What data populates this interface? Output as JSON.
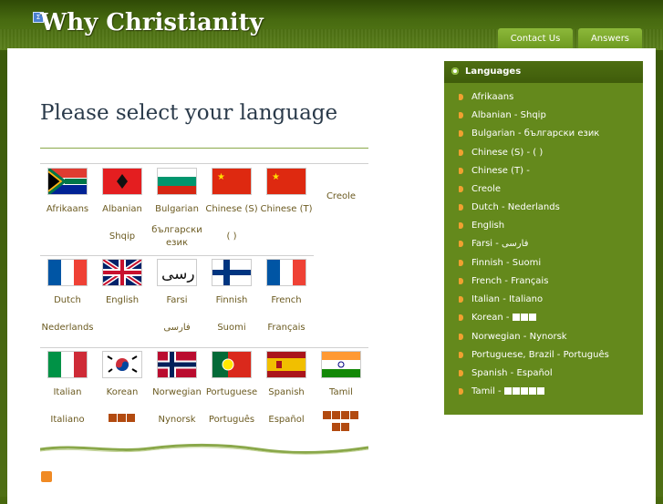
{
  "header": {
    "title": "Why Christianity",
    "tabs": [
      "Contact Us",
      "Answers"
    ]
  },
  "main": {
    "heading": "Please select your language",
    "languages": [
      {
        "name": "Afrikaans",
        "native": ""
      },
      {
        "name": "Albanian",
        "native": "Shqip"
      },
      {
        "name": "Bulgarian",
        "native": "български език"
      },
      {
        "name": "Chinese (S)",
        "native": "(   )"
      },
      {
        "name": "Chinese (T)",
        "native": ""
      },
      {
        "name": "Creole",
        "native": ""
      },
      {
        "name": "Dutch",
        "native": "Nederlands"
      },
      {
        "name": "English",
        "native": ""
      },
      {
        "name": "Farsi",
        "native": "فارسی"
      },
      {
        "name": "Finnish",
        "native": "Suomi"
      },
      {
        "name": "French",
        "native": "Français"
      },
      {
        "name": "Italian",
        "native": "Italiano"
      },
      {
        "name": "Korean",
        "native": ""
      },
      {
        "name": "Norwegian",
        "native": "Nynorsk"
      },
      {
        "name": "Portuguese",
        "native": "Português"
      },
      {
        "name": "Spanish",
        "native": "Español"
      },
      {
        "name": "Tamil",
        "native": ""
      }
    ]
  },
  "sidebar": {
    "title": "Languages",
    "items": [
      "Afrikaans",
      "Albanian - Shqip",
      "Bulgarian - български език",
      "Chinese (S) -    (   )",
      "Chinese (T) -",
      "Creole",
      "Dutch - Nederlands",
      "English",
      "Farsi - فارسی",
      "Finnish - Suomi",
      "French - Français",
      "Italian - Italiano",
      "Korean -",
      "Norwegian - Nynorsk",
      "Portuguese, Brazil - Português",
      "Spanish - Español",
      "Tamil -"
    ]
  },
  "colors": {
    "green_dark": "#3f5c0a",
    "sidebar_green": "#64891c",
    "label_brown": "#6b5a20",
    "bullet_orange": "#f0a030"
  }
}
